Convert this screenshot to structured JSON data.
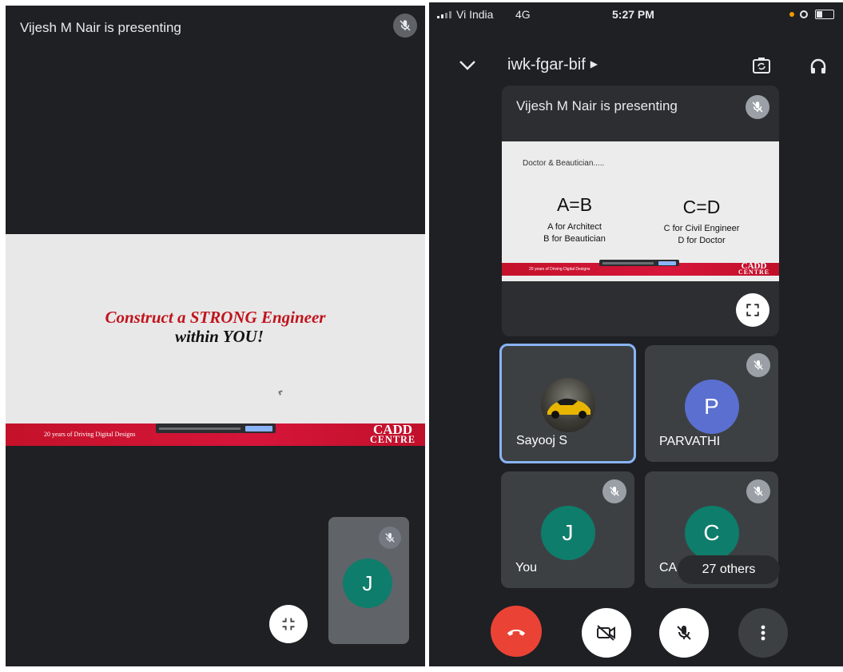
{
  "left": {
    "presenter_banner": "Vijesh M Nair is presenting",
    "slide": {
      "line1": "Construct a STRONG Engineer",
      "line2": "within YOU!",
      "footer_tag": "20 years of Driving Digital Designs",
      "brand_top": "CADD",
      "brand_bottom": "CENTRE"
    },
    "self_tile_initial": "J"
  },
  "right": {
    "status": {
      "carrier": "Vi India",
      "network": "4G",
      "time": "5:27 PM"
    },
    "meeting_code": "iwk-fgar-bif",
    "presenter_banner": "Vijesh M Nair is presenting",
    "slide": {
      "heading": "Doctor & Beautician.....",
      "eq_left": "A=B",
      "desc_left_1": "A for Architect",
      "desc_left_2": "B for Beautician",
      "eq_right": "C=D",
      "desc_right_1": "C for Civil Engineer",
      "desc_right_2": "D for Doctor",
      "footer_tag": "20 years of Driving Digital Designs",
      "brand_top": "CADD",
      "brand_bottom": "CENTRE"
    },
    "participants": [
      {
        "name": "Sayooj S",
        "initial": "",
        "color": "",
        "selected": true,
        "muted": false
      },
      {
        "name": "PARVATHI",
        "initial": "P",
        "color": "#5b6fd0",
        "selected": false,
        "muted": true
      },
      {
        "name": "You",
        "initial": "J",
        "color": "#0f7d6b",
        "selected": false,
        "muted": true
      },
      {
        "name": "CA",
        "initial": "C",
        "color": "#0f7d6b",
        "selected": false,
        "muted": true
      }
    ],
    "others_label": "27 others"
  },
  "colors": {
    "end_call": "#ea4335",
    "selected_border": "#8ab4f8",
    "background": "#1f2024"
  },
  "icons": [
    "mic-off-icon",
    "exit-fullscreen-icon",
    "chevron-down-icon",
    "camera-flip-icon",
    "headphones-icon",
    "fullscreen-icon",
    "end-call-icon",
    "camera-off-icon",
    "more-vert-icon"
  ]
}
